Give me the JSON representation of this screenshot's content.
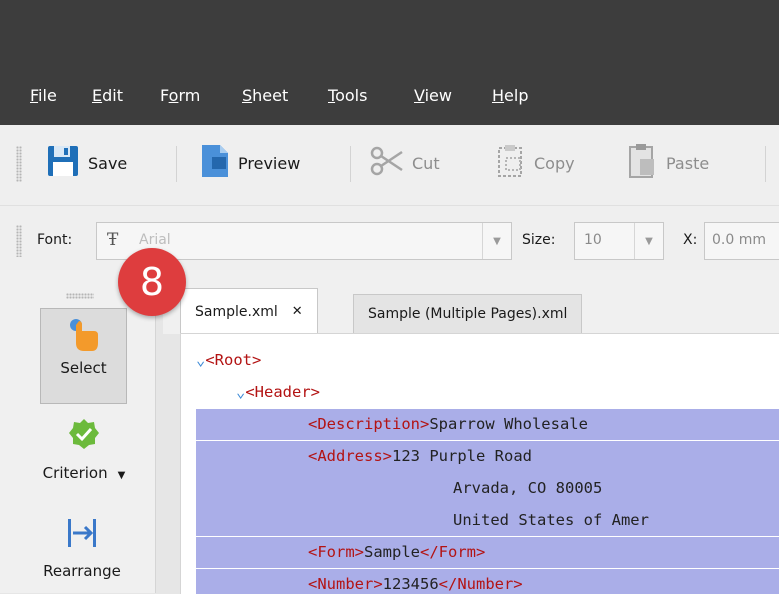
{
  "menu": [
    {
      "label": "File",
      "accel": "F"
    },
    {
      "label": "Edit",
      "accel": "E"
    },
    {
      "label": "Form",
      "accel": "o"
    },
    {
      "label": "Sheet",
      "accel": "S"
    },
    {
      "label": "Tools",
      "accel": "T"
    },
    {
      "label": "View",
      "accel": "V"
    },
    {
      "label": "Help",
      "accel": "H"
    }
  ],
  "toolbar": {
    "save": "Save",
    "preview": "Preview",
    "cut": "Cut",
    "copy": "Copy",
    "paste": "Paste"
  },
  "fontbar": {
    "font_label": "Font:",
    "font_value": "Arial",
    "size_label": "Size:",
    "size_value": "10",
    "x_label": "X:",
    "x_value": "0.0 mm"
  },
  "tools": {
    "select": "Select",
    "criterion": "Criterion",
    "rearrange": "Rearrange"
  },
  "tabs": [
    {
      "label": "Sample.xml",
      "close": "✕",
      "active": true
    },
    {
      "label": "Sample (Multiple Pages).xml",
      "active": false
    }
  ],
  "badge": "8",
  "xml": {
    "root_open": "<Root>",
    "header_open": "<Header>",
    "desc_open": "<Description>",
    "desc_text": "Sparrow Wholesale",
    "addr_open": "<Address>",
    "addr_line1": "123 Purple Road",
    "addr_line2": "Arvada, CO 80005",
    "addr_line3": "United States of Amer",
    "form_open": "<Form>",
    "form_text": "Sample",
    "form_close": "</Form>",
    "num_open": "<Number>",
    "num_text": "123456",
    "num_close": "</Number>"
  },
  "colors": {
    "chrome": "#3d3d3d",
    "selection": "#aaaee8",
    "tag": "#b31313",
    "badge": "#de3d3e"
  }
}
